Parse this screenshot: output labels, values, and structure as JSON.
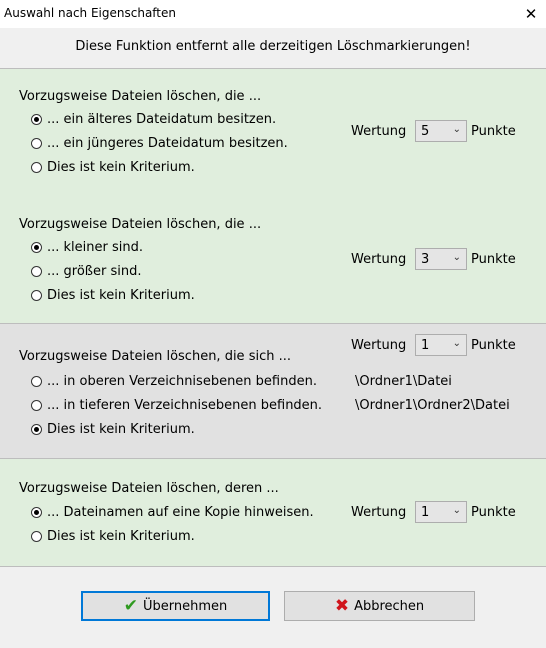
{
  "window": {
    "title": "Auswahl nach Eigenschaften",
    "close_glyph": "✕"
  },
  "notice": "Diese Funktion entfernt alle derzeitigen Löschmarkierungen!",
  "common": {
    "wertung_label": "Wertung",
    "punkte_label": "Punkte"
  },
  "sections": [
    {
      "heading": "Vorzugsweise Dateien löschen, die ...",
      "options": [
        {
          "label": "... ein älteres Dateidatum besitzen.",
          "checked": true
        },
        {
          "label": "... ein jüngeres Dateidatum besitzen.",
          "checked": false
        },
        {
          "label": "Dies ist kein Kriterium.",
          "checked": false
        }
      ],
      "wertung": "5"
    },
    {
      "heading": "Vorzugsweise Dateien löschen, die ...",
      "options": [
        {
          "label": "... kleiner sind.",
          "checked": true
        },
        {
          "label": "... größer sind.",
          "checked": false
        },
        {
          "label": "Dies ist kein Kriterium.",
          "checked": false
        }
      ],
      "wertung": "3"
    },
    {
      "heading": "Vorzugsweise Dateien löschen, die sich ...",
      "options": [
        {
          "label": "... in oberen Verzeichnisebenen befinden.",
          "checked": false,
          "example": "\\Ordner1\\Datei"
        },
        {
          "label": "... in tieferen Verzeichnisebenen befinden.",
          "checked": false,
          "example": "\\Ordner1\\Ordner2\\Datei"
        },
        {
          "label": "Dies ist kein Kriterium.",
          "checked": true
        }
      ],
      "wertung": "1"
    },
    {
      "heading": "Vorzugsweise Dateien löschen, deren ...",
      "options": [
        {
          "label": "... Dateinamen auf eine Kopie hinweisen.",
          "checked": true
        },
        {
          "label": "Dies ist kein Kriterium.",
          "checked": false
        }
      ],
      "wertung": "1"
    }
  ],
  "buttons": {
    "ok": {
      "label": "Übernehmen",
      "icon": "checkmark-icon"
    },
    "cancel": {
      "label": "Abbrechen",
      "icon": "cross-icon"
    }
  },
  "colors": {
    "section_green": "#e0eedd",
    "section_gray": "#e1e1e1",
    "ok_icon": "#2f9a20",
    "cancel_icon": "#d0141b",
    "focus_border": "#0078d7"
  }
}
